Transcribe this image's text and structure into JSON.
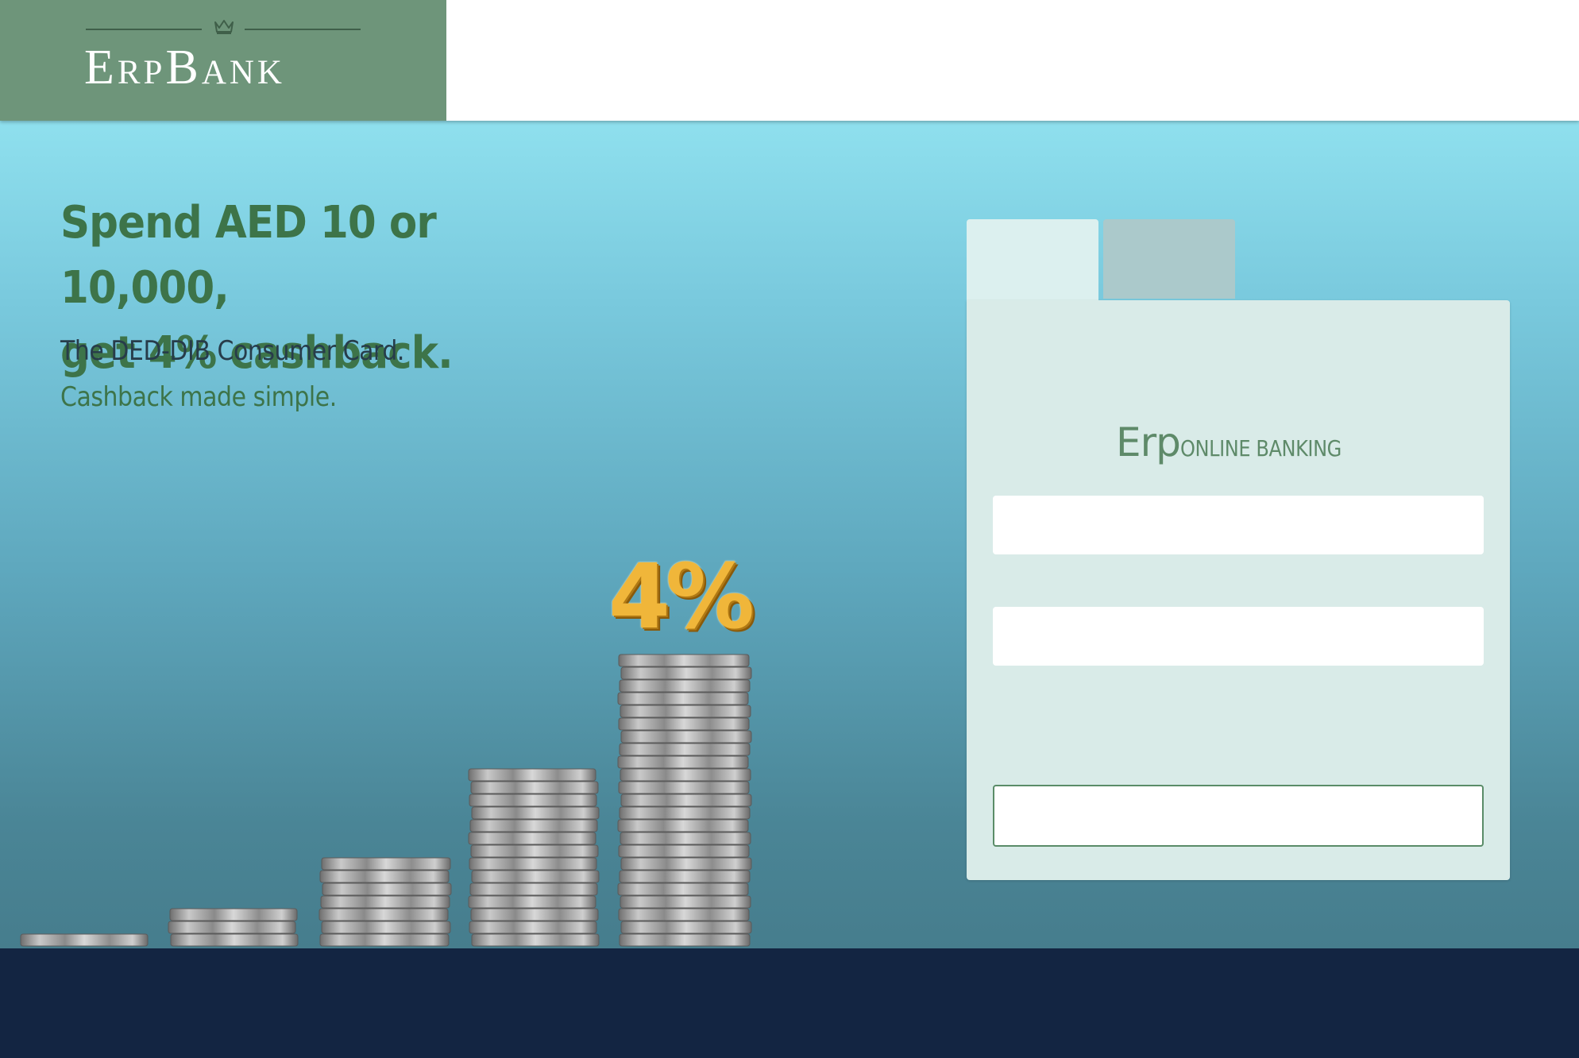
{
  "header": {
    "logo_text": "ErpBank",
    "logo_icon": "crown-icon",
    "brand_color": "#6e957a"
  },
  "hero": {
    "headline_line1": "Spend AED 10 or 10,000,",
    "headline_line2": "get 4% cashback.",
    "subline1": "The DED-DIB Consumer Card.",
    "subline2": "Cashback made simple.",
    "percent_badge": "4%",
    "accent_green": "#3d7449",
    "badge_gold": "#f0b63a"
  },
  "login": {
    "tabs": [
      {
        "label": ""
      },
      {
        "label": ""
      }
    ],
    "brand_prefix": "Erp",
    "brand_suffix": "ONLINE BANKING",
    "username": {
      "value": "",
      "placeholder": ""
    },
    "password": {
      "value": "",
      "placeholder": ""
    },
    "submit_label": ""
  },
  "footer": {
    "color": "#132542"
  }
}
